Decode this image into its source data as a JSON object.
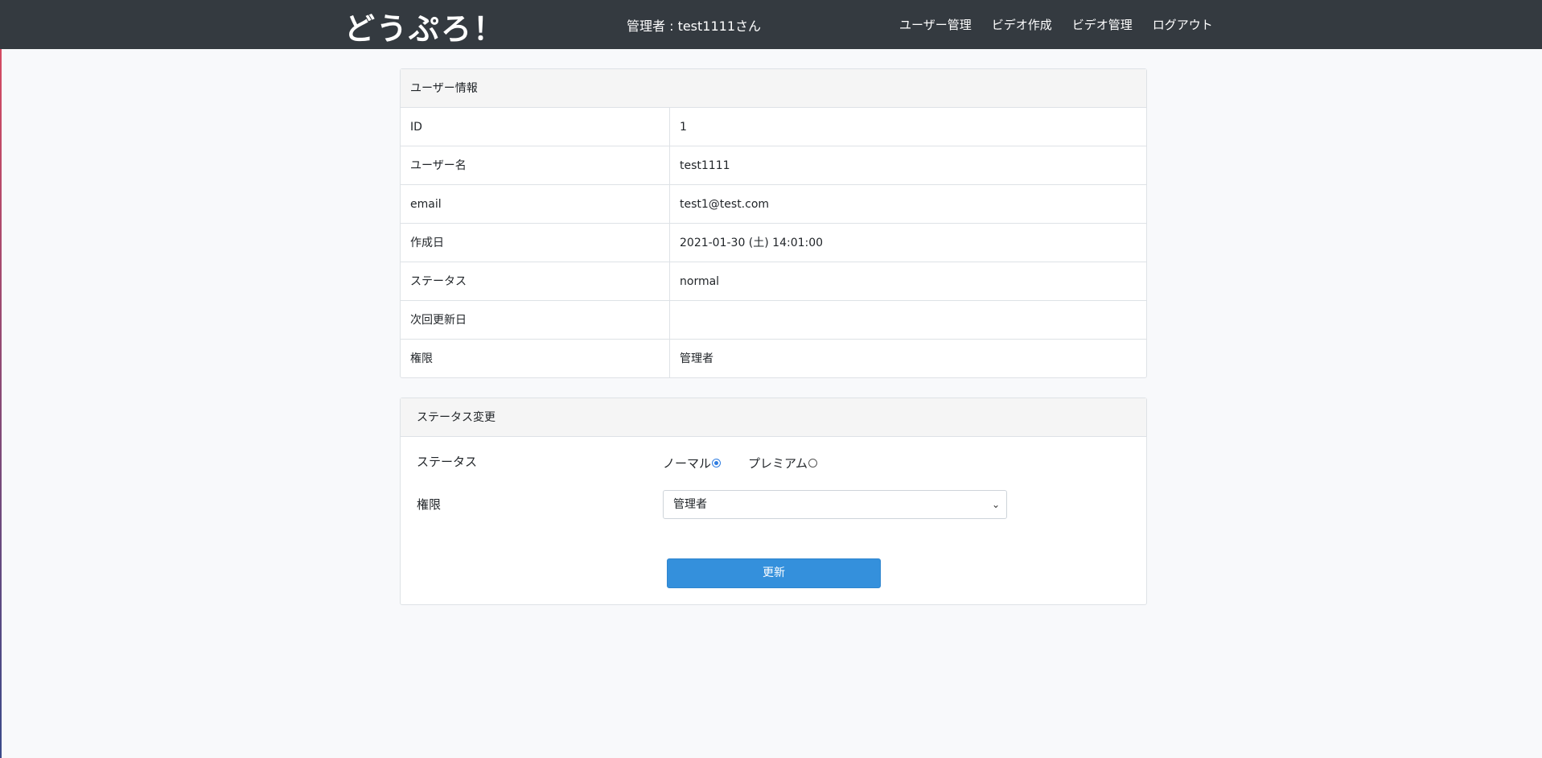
{
  "header": {
    "brand": "どうぷろ！",
    "admin_label": "管理者 : test1111さん",
    "nav": [
      {
        "label": "ユーザー管理"
      },
      {
        "label": "ビデオ作成"
      },
      {
        "label": "ビデオ管理"
      },
      {
        "label": "ログアウト"
      }
    ]
  },
  "user_info": {
    "title": "ユーザー情報",
    "rows": [
      {
        "key": "ID",
        "value": "1"
      },
      {
        "key": "ユーザー名",
        "value": "test1111"
      },
      {
        "key": "email",
        "value": "test1@test.com"
      },
      {
        "key": "作成日",
        "value": "2021-01-30 (土) 14:01:00"
      },
      {
        "key": "ステータス",
        "value": "normal"
      },
      {
        "key": "次回更新日",
        "value": ""
      },
      {
        "key": "権限",
        "value": "管理者"
      }
    ]
  },
  "status_form": {
    "title": "ステータス変更",
    "status_label": "ステータス",
    "options": [
      {
        "label": "ノーマル",
        "checked": true
      },
      {
        "label": "プレミアム",
        "checked": false
      }
    ],
    "role_label": "権限",
    "role_selected": "管理者",
    "submit_label": "更新"
  },
  "colors": {
    "navbar": "#343a40",
    "accent": "#3490dc"
  }
}
